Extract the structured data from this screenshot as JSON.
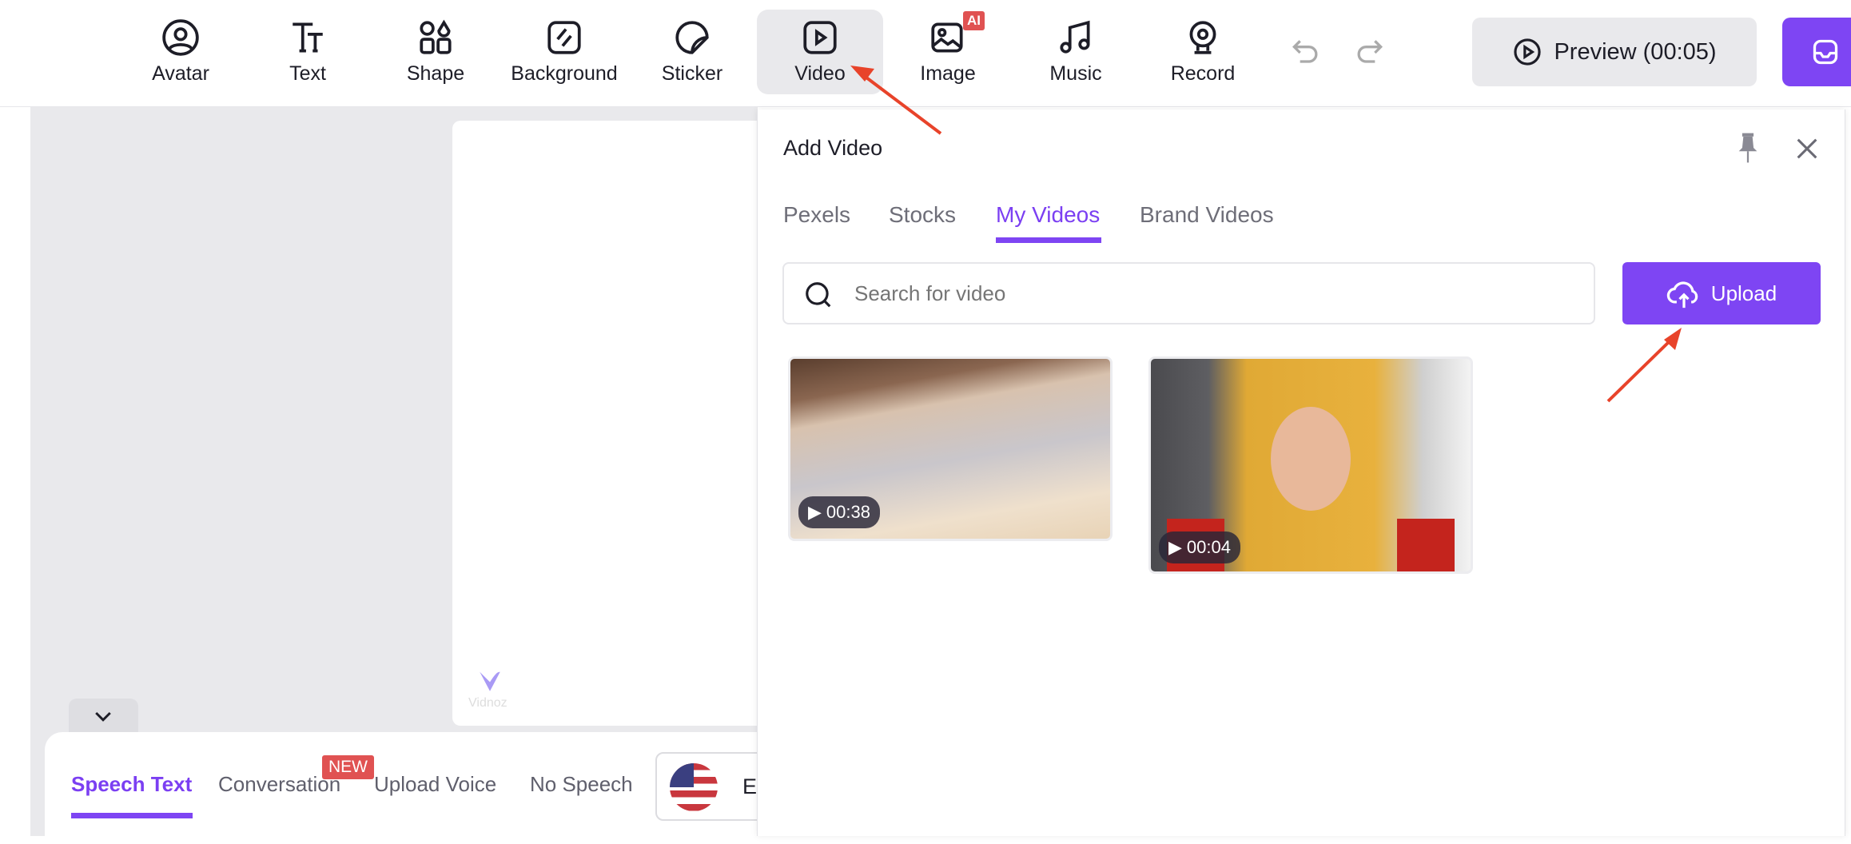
{
  "toolbar": {
    "items": [
      {
        "label": "Avatar",
        "icon": "avatar-icon"
      },
      {
        "label": "Text",
        "icon": "text-icon"
      },
      {
        "label": "Shape",
        "icon": "shape-icon"
      },
      {
        "label": "Background",
        "icon": "background-icon"
      },
      {
        "label": "Sticker",
        "icon": "sticker-icon"
      },
      {
        "label": "Video",
        "icon": "video-icon",
        "active": true
      },
      {
        "label": "Image",
        "icon": "image-icon",
        "badge": "AI"
      },
      {
        "label": "Music",
        "icon": "music-icon"
      },
      {
        "label": "Record",
        "icon": "webcam-icon"
      }
    ],
    "preview_label": "Preview (00:05)"
  },
  "canvas": {
    "watermark": "Vidnoz"
  },
  "panel": {
    "title": "Add Video",
    "tabs": [
      "Pexels",
      "Stocks",
      "My Videos",
      "Brand Videos"
    ],
    "active_tab": "My Videos",
    "search_placeholder": "Search for video",
    "upload_label": "Upload",
    "videos": [
      {
        "duration": "00:38"
      },
      {
        "duration": "00:04"
      }
    ]
  },
  "speech": {
    "tabs": [
      "Speech Text",
      "Conversation",
      "Upload Voice",
      "No Speech"
    ],
    "active_tab": "Speech Text",
    "new_badge": "NEW",
    "language_initial": "E"
  },
  "colors": {
    "accent": "#7e45f3",
    "annotation_arrow": "#e8432a",
    "new_badge": "#e05252"
  }
}
